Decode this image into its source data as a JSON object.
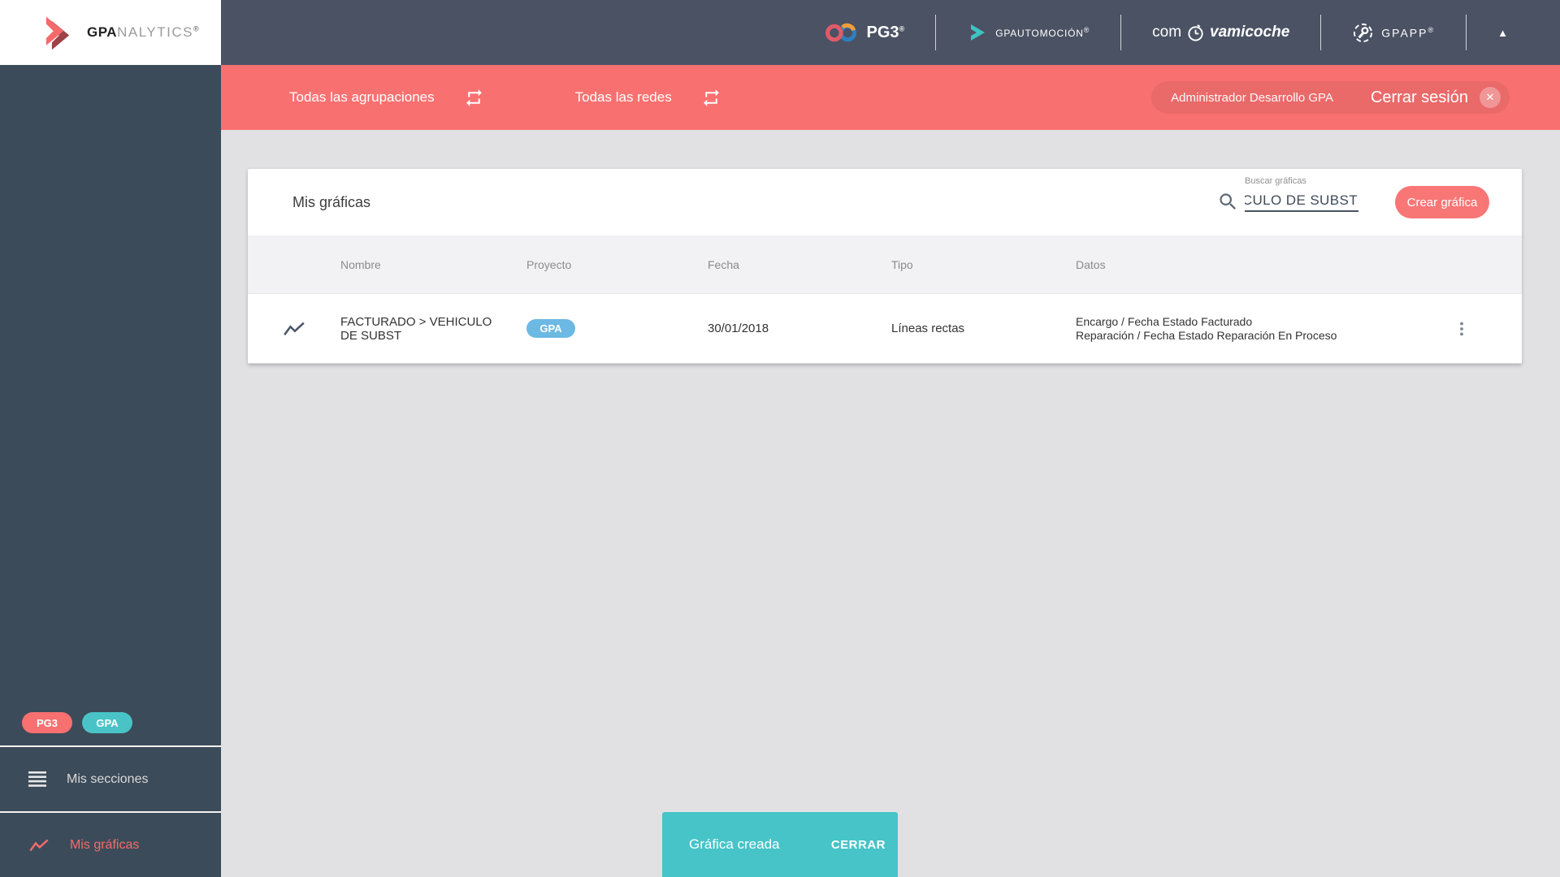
{
  "topbar": {
    "brand": {
      "bold": "GPA",
      "light": "NALYTICS",
      "reg": "®"
    },
    "pg3": {
      "label": "PG3",
      "reg": "®"
    },
    "gpautomocion": {
      "label": "GPAUTOMOCIÓN",
      "reg": "®"
    },
    "compravamicoche": {
      "pre": "com",
      "post": "vamicoche"
    },
    "gpapp": {
      "label": "GPAPP",
      "reg": "®"
    }
  },
  "filterbar": {
    "groupings_label": "Todas las agrupaciones",
    "networks_label": "Todas las redes",
    "user_name": "Administrador Desarrollo GPA",
    "logout_label": "Cerrar sesión",
    "logout_close_glyph": "✕"
  },
  "sidebar": {
    "badge_pg3": "PG3",
    "badge_gpa": "GPA",
    "sections_label": "Mis secciones",
    "charts_label": "Mis gráficas"
  },
  "content": {
    "title": "Mis gráficas",
    "search_label": "Buscar gráficas",
    "search_value": "CULO DE SUBST",
    "create_button": "Crear gráfica",
    "table": {
      "headers": [
        "Nombre",
        "Proyecto",
        "Fecha",
        "Tipo",
        "Datos"
      ],
      "rows": [
        {
          "nombre": "FACTURADO > VEHICULO DE SUBST",
          "proyecto": "GPA",
          "fecha": "30/01/2018",
          "tipo": "Líneas rectas",
          "datos": [
            "Encargo / Fecha Estado Facturado",
            "Reparación / Fecha Estado Reparación En Proceso"
          ]
        }
      ]
    }
  },
  "snackbar": {
    "message": "Gráfica creada",
    "action": "CERRAR"
  },
  "topbar_caret_glyph": "▲",
  "colors": {
    "accent_red": "#f97070",
    "header_slate": "#4a5263",
    "sidebar_slate": "#3c4b59",
    "snackbar_teal": "#46c4c8",
    "project_badge_blue": "#6cb9e3",
    "sidebar_badge_teal": "#4ac3c7",
    "active_item_red": "#f56b6b",
    "content_bg": "#e1e1e4"
  }
}
